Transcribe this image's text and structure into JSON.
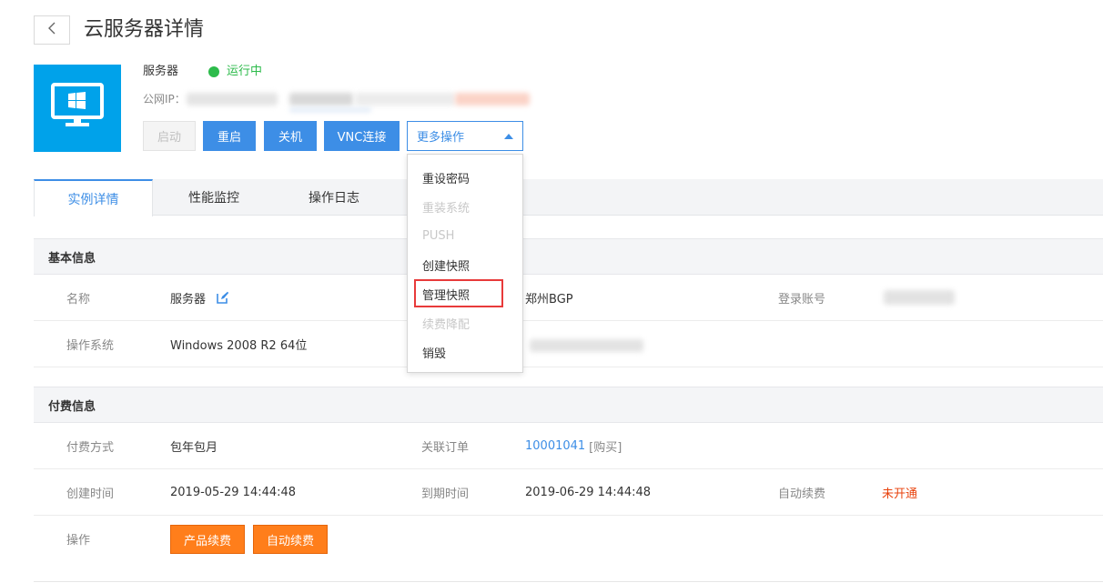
{
  "header": {
    "back_icon": "chevron-left-icon",
    "title": "云服务器详情"
  },
  "server": {
    "tile_icon": "windows-monitor-icon",
    "name": "服务器",
    "status": "运行中",
    "status_color": "#2dbb4b",
    "public_ip_label": "公网IP："
  },
  "actions": {
    "start": "启动",
    "restart": "重启",
    "shutdown": "关机",
    "vnc": "VNC连接",
    "more": "更多操作"
  },
  "more_menu": [
    {
      "label": "重设密码",
      "enabled": true
    },
    {
      "label": "重装系统",
      "enabled": false
    },
    {
      "label": "PUSH",
      "enabled": false
    },
    {
      "label": "创建快照",
      "enabled": true
    },
    {
      "label": "管理快照",
      "enabled": true
    },
    {
      "label": "续费降配",
      "enabled": false
    },
    {
      "label": "销毁",
      "enabled": true
    }
  ],
  "tabs": [
    {
      "label": "实例详情",
      "active": true
    },
    {
      "label": "性能监控",
      "active": false
    },
    {
      "label": "操作日志",
      "active": false
    }
  ],
  "basic_info": {
    "heading": "基本信息",
    "name_label": "名称",
    "name_value": "服务器",
    "region_value": "郑州BGP",
    "login_label": "登录账号",
    "os_label": "操作系统",
    "os_value": "Windows 2008 R2 64位"
  },
  "billing_info": {
    "heading": "付费信息",
    "pay_method_label": "付费方式",
    "pay_method_value": "包年包月",
    "order_label": "关联订单",
    "order_id": "10001041",
    "order_tag": "[购买]",
    "created_label": "创建时间",
    "created_value": "2019-05-29 14:44:48",
    "expire_label": "到期时间",
    "expire_value": "2019-06-29 14:44:48",
    "auto_renew_label": "自动续费",
    "auto_renew_value": "未开通",
    "ops_label": "操作",
    "renew_button": "产品续费",
    "auto_renew_button": "自动续费"
  },
  "colors": {
    "primary": "#3d8ee6",
    "tile": "#00a2ea",
    "orange": "#ff7e1b",
    "danger": "#e8420c",
    "highlight_box": "#e83a3a"
  }
}
